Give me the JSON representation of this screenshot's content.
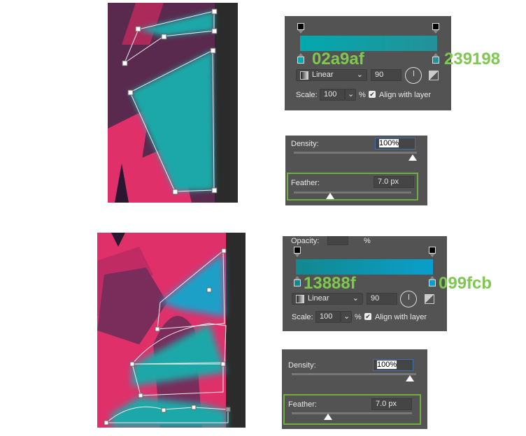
{
  "top": {
    "gradient": {
      "start_hex": "02a9af",
      "end_hex": "239198",
      "start_color": "#02a9af",
      "end_color": "#239198"
    },
    "style": "Linear",
    "angle": "90",
    "scale_label": "Scale:",
    "scale": "100",
    "percent": "%",
    "align_label": "Align with layer",
    "align_checked": true,
    "density_label": "Density:",
    "density": "100%",
    "density_level": 1.0,
    "feather_label": "Feather:",
    "feather": "7.0 px"
  },
  "bottom": {
    "opacity_label": "Opacity:",
    "opacity_unit": "%",
    "gradient": {
      "start_hex": "13888f",
      "end_hex": "099fcb",
      "start_color": "#13888f",
      "end_color": "#099fcb"
    },
    "style": "Linear",
    "angle": "90",
    "scale_label": "Scale:",
    "scale": "100",
    "percent": "%",
    "align_label": "Align with layer",
    "align_checked": true,
    "density_label": "Density:",
    "density": "100%",
    "density_level": 1.0,
    "feather_label": "Feather:",
    "feather": "7.0 px"
  },
  "colors": {
    "highlight_green": "#7ec850",
    "artwork_pink": "#e0306a",
    "artwork_teal": "#1aa8a8"
  }
}
